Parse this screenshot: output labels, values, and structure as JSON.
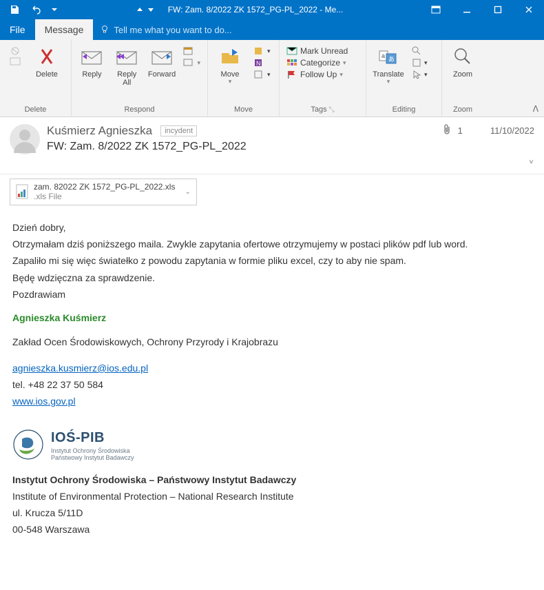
{
  "titlebar": {
    "title": "FW: Zam. 8/2022 ZK 1572_PG-PL_2022 - Me..."
  },
  "tabs": {
    "file": "File",
    "message": "Message",
    "tellme": "Tell me what you want to do..."
  },
  "ribbon": {
    "delete": "Delete",
    "reply": "Reply",
    "replyAll": "Reply\nAll",
    "forward": "Forward",
    "move": "Move",
    "markUnread": "Mark Unread",
    "categorize": "Categorize",
    "followUp": "Follow Up",
    "translate": "Translate",
    "zoom": "Zoom",
    "groups": {
      "delete": "Delete",
      "respond": "Respond",
      "move": "Move",
      "tags": "Tags",
      "editing": "Editing",
      "zoom": "Zoom"
    }
  },
  "header": {
    "sender": "Kuśmierz Agnieszka",
    "tag": "incydent",
    "attachCount": "1",
    "date": "11/10/2022",
    "subject": "FW: Zam. 8/2022 ZK 1572_PG-PL_2022"
  },
  "attachment": {
    "name": "zam. 82022 ZK 1572_PG-PL_2022.xls",
    "type": ".xls File"
  },
  "body": {
    "greeting": "Dzień dobry,",
    "p1": "Otrzymałam dziś poniższego maila. Zwykle zapytania ofertowe otrzymujemy w postaci plików pdf lub word.",
    "p2": "Zapaliło mi się więc światełko z powodu zapytania w formie pliku excel, czy to aby nie spam.",
    "p3": "Będę wdzięczna za sprawdzenie.",
    "p4": "Pozdrawiam",
    "sigName": "Agnieszka Kuśmierz",
    "sigDept": "Zakład Ocen Środowiskowych, Ochrony Przyrody i Krajobrazu",
    "email": "agnieszka.kusmierz@ios.edu.pl",
    "phone": "tel. +48 22 37 50 584",
    "web": "www.ios.gov.pl",
    "logoTitle": "IOŚ-PIB",
    "logoSub1": "Instytut Ochrony Środowiska",
    "logoSub2": "Państwowy Instytut Badawczy",
    "inst1": "Instytut Ochrony Środowiska – Państwowy Instytut Badawczy",
    "inst2": "Institute of Environmental Protection – National Research Institute",
    "inst3": "ul. Krucza 5/11D",
    "inst4": "00-548 Warszawa"
  }
}
